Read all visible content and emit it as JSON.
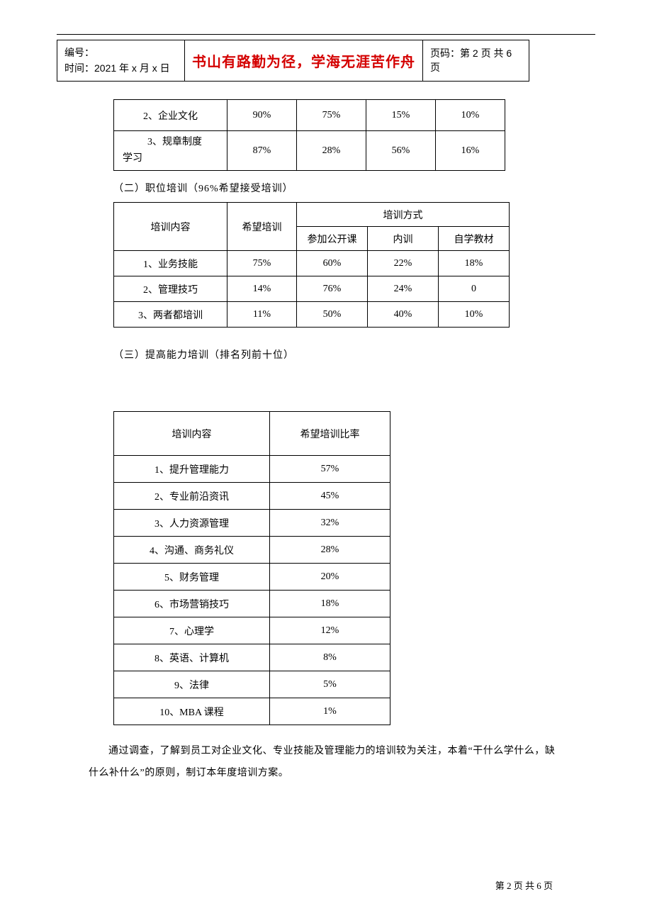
{
  "header": {
    "left_line1": "编号：",
    "left_line2": "时间：2021 年 x 月 x 日",
    "center": "书山有路勤为径，学海无涯苦作舟",
    "right": "页码：第 2 页  共 6 页"
  },
  "table1": {
    "rows": [
      {
        "label": "2、企业文化",
        "center": true,
        "v": [
          "90%",
          "75%",
          "15%",
          "10%"
        ]
      },
      {
        "label_top": "3、规章制度",
        "label_bottom": "学习",
        "v": [
          "87%",
          "28%",
          "56%",
          "16%"
        ]
      }
    ]
  },
  "section2_heading": "（二）职位培训（96%希望接受培训）",
  "table2": {
    "col_content": "培训内容",
    "col_hope": "希望培训",
    "col_method_group": "培训方式",
    "col_m1": "参加公开课",
    "col_m2": "内训",
    "col_m3": "自学教材",
    "rows": [
      {
        "label": "1、业务技能",
        "hope": "75%",
        "m": [
          "60%",
          "22%",
          "18%"
        ]
      },
      {
        "label": "2、管理技巧",
        "hope": "14%",
        "m": [
          "76%",
          "24%",
          "0"
        ]
      },
      {
        "label": "3、两者都培训",
        "hope": "11%",
        "m": [
          "50%",
          "40%",
          "10%"
        ]
      }
    ]
  },
  "section3_heading": "（三）提高能力培训（排名列前十位）",
  "table3": {
    "col_a": "培训内容",
    "col_b": "希望培训比率",
    "rows": [
      {
        "a": "1、提升管理能力",
        "b": "57%"
      },
      {
        "a": "2、专业前沿资讯",
        "b": "45%"
      },
      {
        "a": "3、人力资源管理",
        "b": "32%"
      },
      {
        "a": "4、沟通、商务礼仪",
        "b": "28%"
      },
      {
        "a": "5、财务管理",
        "b": "20%"
      },
      {
        "a": "6、市场营销技巧",
        "b": "18%"
      },
      {
        "a": "7、心理学",
        "b": "12%"
      },
      {
        "a": "8、英语、计算机",
        "b": "8%"
      },
      {
        "a": "9、法律",
        "b": "5%"
      },
      {
        "a": "10、MBA 课程",
        "b": "1%"
      }
    ]
  },
  "paragraph": "通过调查，了解到员工对企业文化、专业技能及管理能力的培训较为关注，本着“干什么学什么，缺什么补什么”的原则，制订本年度培训方案。",
  "footer": "第 2 页 共 6 页"
}
